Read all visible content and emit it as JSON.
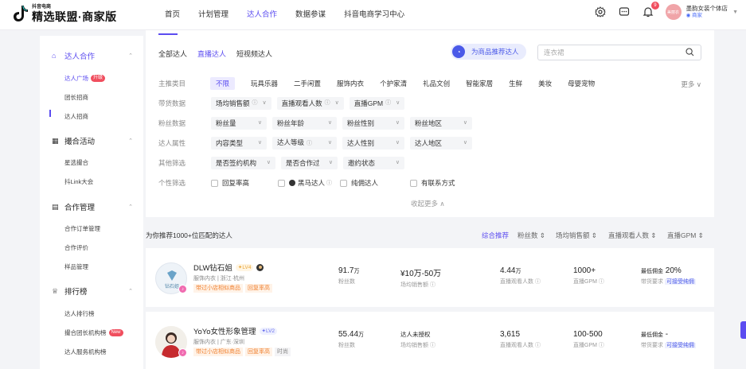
{
  "header": {
    "logo_sub": "抖音电商",
    "logo_main": "精选联盟·商家版",
    "nav": [
      "首页",
      "计划管理",
      "达人合作",
      "数据参谋",
      "抖音电商学习中心"
    ],
    "active_nav_index": 2,
    "notification_count": "9",
    "avatar_text": "美丽衣",
    "store_name": "墨韵女装个体店",
    "store_tag": "商家",
    "brand_color": "#5b4cf0"
  },
  "sidebar": {
    "groups": [
      {
        "label": "达人合作",
        "icon": "home-icon",
        "active": true,
        "items": [
          {
            "label": "达人广场",
            "tag": "升级",
            "active": true
          },
          {
            "label": "团长招商"
          },
          {
            "label": "达人招商"
          }
        ]
      },
      {
        "label": "撮合活动",
        "icon": "grid-icon",
        "items": [
          {
            "label": "星选撮合"
          },
          {
            "label": "抖Link大会"
          }
        ]
      },
      {
        "label": "合作管理",
        "icon": "doc-icon",
        "items": [
          {
            "label": "合作订单管理"
          },
          {
            "label": "合作评价"
          },
          {
            "label": "样品管理"
          }
        ]
      },
      {
        "label": "排行榜",
        "icon": "trophy-icon",
        "items": [
          {
            "label": "达人排行榜"
          },
          {
            "label": "撮合团长机构榜",
            "tag": "New"
          },
          {
            "label": "达人服务机构榜"
          }
        ]
      }
    ]
  },
  "filters": {
    "tabs": [
      "全部达人",
      "直播达人",
      "短视频达人"
    ],
    "active_tab": 1,
    "recommend_btn": "为商品推荐达人",
    "search_placeholder": "连衣裙",
    "main_category_label": "主推类目",
    "categories": [
      "不限",
      "玩具乐器",
      "二手闲置",
      "服饰内衣",
      "个护家清",
      "礼品文创",
      "智能家居",
      "生鲜",
      "美妆",
      "母婴宠物"
    ],
    "more": "更多",
    "rows": [
      {
        "label": "带货数据",
        "dropdowns": [
          {
            "text": "场均销售额",
            "q": true
          },
          {
            "text": "直播观看人数",
            "q": true
          },
          {
            "text": "直播GPM",
            "q": true
          }
        ]
      },
      {
        "label": "粉丝数据",
        "dropdowns": [
          {
            "text": "粉丝量"
          },
          {
            "text": "粉丝年龄"
          },
          {
            "text": "粉丝性别"
          },
          {
            "text": "粉丝地区"
          }
        ]
      },
      {
        "label": "达人属性",
        "dropdowns": [
          {
            "text": "内容类型"
          },
          {
            "text": "达人等级",
            "q": true
          },
          {
            "text": "达人性别"
          },
          {
            "text": "达人地区"
          }
        ]
      },
      {
        "label": "其他筛选",
        "dropdowns": [
          {
            "text": "是否签约机构"
          },
          {
            "text": "是否合作过"
          },
          {
            "text": "邀约状态"
          }
        ]
      }
    ],
    "personal_label": "个性筛选",
    "checkboxes": [
      "回复率高",
      "黑马达人",
      "纯佣达人",
      "有联系方式"
    ],
    "collapse": "收起更多"
  },
  "results": {
    "summary": "为你推荐1000+位匹配的达人",
    "sorts": [
      "综合推荐",
      "粉丝数",
      "场均销售额",
      "直播观看人数",
      "直播GPM"
    ],
    "active_sort": 0
  },
  "creators": [
    {
      "name": "DLW钻石姐",
      "level": "LV4",
      "level_style": "gold",
      "category": "服饰内衣",
      "location": "浙江·杭州",
      "tags": [
        "带过小店相似商品",
        "回复率高"
      ],
      "fans_value": "91.7",
      "fans_unit": "万",
      "fans_label": "粉丝数",
      "sales_value": "¥10万-50万",
      "sales_label": "场均销售额",
      "viewers_value": "4.44",
      "viewers_unit": "万",
      "viewers_label": "直播观看人数",
      "gpm_value": "1000+",
      "gpm_label": "直播GPM",
      "commission_label": "最低佣金",
      "commission_value": "20%",
      "requirement_label": "带货要求",
      "requirement_value": "可接受纯佣",
      "avatar_text": "钻石姐"
    },
    {
      "name": "YoYo女性形象管理",
      "level": "LV2",
      "level_style": "blue",
      "category": "服饰内衣",
      "location": "广东·深圳",
      "tags": [
        "带过小店相似商品",
        "回复率高",
        "时尚"
      ],
      "fans_value": "55.44",
      "fans_unit": "万",
      "fans_label": "粉丝数",
      "sales_value": "达人未授权",
      "sales_label": "场均销售额",
      "viewers_value": "3,615",
      "viewers_unit": "",
      "viewers_label": "直播观看人数",
      "gpm_value": "100-500",
      "gpm_label": "直播GPM",
      "commission_label": "最低佣金",
      "commission_value": "-",
      "requirement_label": "带货要求",
      "requirement_value": "可接受纯佣",
      "avatar_text": ""
    }
  ]
}
